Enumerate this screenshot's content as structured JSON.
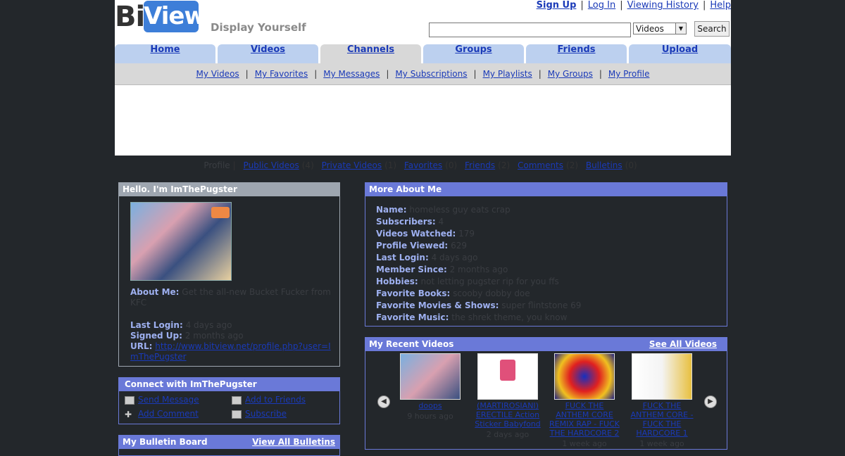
{
  "header": {
    "logo_bit": "Bit",
    "logo_view": "View",
    "tagline": "Display Yourself",
    "links": [
      "Sign Up",
      "Log In",
      "Viewing History",
      "Help"
    ],
    "search": {
      "placeholder": "",
      "select_value": "Videos",
      "button": "Search"
    }
  },
  "tabs": [
    {
      "label": "Home"
    },
    {
      "label": "Videos"
    },
    {
      "label": "Channels",
      "active": true
    },
    {
      "label": "Groups"
    },
    {
      "label": "Friends"
    },
    {
      "label": "Upload"
    }
  ],
  "subnav": [
    "My Videos",
    "My Favorites",
    "My Messages",
    "My Subscriptions",
    "My Playlists",
    "My Groups",
    "My Profile"
  ],
  "profile_nav": {
    "prefix": "Profile",
    "items": [
      {
        "label": "Public Videos",
        "count": "(4)"
      },
      {
        "label": "Private Videos",
        "count": "(1)"
      },
      {
        "label": "Favorites",
        "count": "(0)"
      },
      {
        "label": "Friends",
        "count": "(2)"
      },
      {
        "label": "Comments",
        "count": "(2)"
      },
      {
        "label": "Bulletins",
        "count": "(0)"
      }
    ]
  },
  "hello": {
    "title": "Hello. I'm ImThePugster",
    "about_label": "About Me:",
    "about_value": "Get the all-new Bucket Fucker from KFC",
    "last_login_label": "Last Login:",
    "last_login_value": "4 days ago",
    "signed_up_label": "Signed Up:",
    "signed_up_value": "2 months ago",
    "url_label": "URL:",
    "url_value": "http://www.bitview.net/profile.php?user=ImThePugster"
  },
  "connect": {
    "title": "Connect with ImThePugster",
    "send_message": "Send Message",
    "add_friends": "Add to Friends",
    "add_comment": "Add Comment",
    "subscribe": "Subscribe"
  },
  "bulletin": {
    "title": "My Bulletin Board",
    "view_all": "View All Bulletins"
  },
  "more": {
    "title": "More About Me",
    "rows": [
      {
        "label": "Name:",
        "value": "homeless guy eats crap"
      },
      {
        "label": "Subscribers:",
        "value": "4"
      },
      {
        "label": "Videos Watched:",
        "value": "179"
      },
      {
        "label": "Profile Viewed:",
        "value": "629"
      },
      {
        "label": "Last Login:",
        "value": "4 days ago"
      },
      {
        "label": "Member Since:",
        "value": "2 months ago"
      },
      {
        "label": "Hobbies:",
        "value": "not letting pugster rip for you ffs"
      },
      {
        "label": "Favorite Books:",
        "value": "scooby dobby doe"
      },
      {
        "label": "Favorite Movies & Shows:",
        "value": "super flintstone 69"
      },
      {
        "label": "Favorite Music:",
        "value": "the shrek theme, you know"
      }
    ]
  },
  "recent": {
    "title": "My Recent Videos",
    "see_all": "See All Videos",
    "videos": [
      {
        "title": "doops",
        "ago": "9 hours ago"
      },
      {
        "title": "(MARTIROSIANI) ERECTILE Action Sticker Babyfond",
        "ago": "2 days ago"
      },
      {
        "title": "FUCK THE ANTHEM CORE REMIX RAP - FUCK THE HARDCORE 2",
        "ago": "1 week ago"
      },
      {
        "title": "FUCK THE ANTHEM CORE - FUCK THE HARDCORE 1",
        "ago": "1 week ago"
      }
    ]
  },
  "colors": {
    "header_blue": "#6a79d8",
    "tab_blue": "#bcd0ef",
    "link": "#1a3ab8",
    "logo_blue": "#3d7ed8"
  }
}
